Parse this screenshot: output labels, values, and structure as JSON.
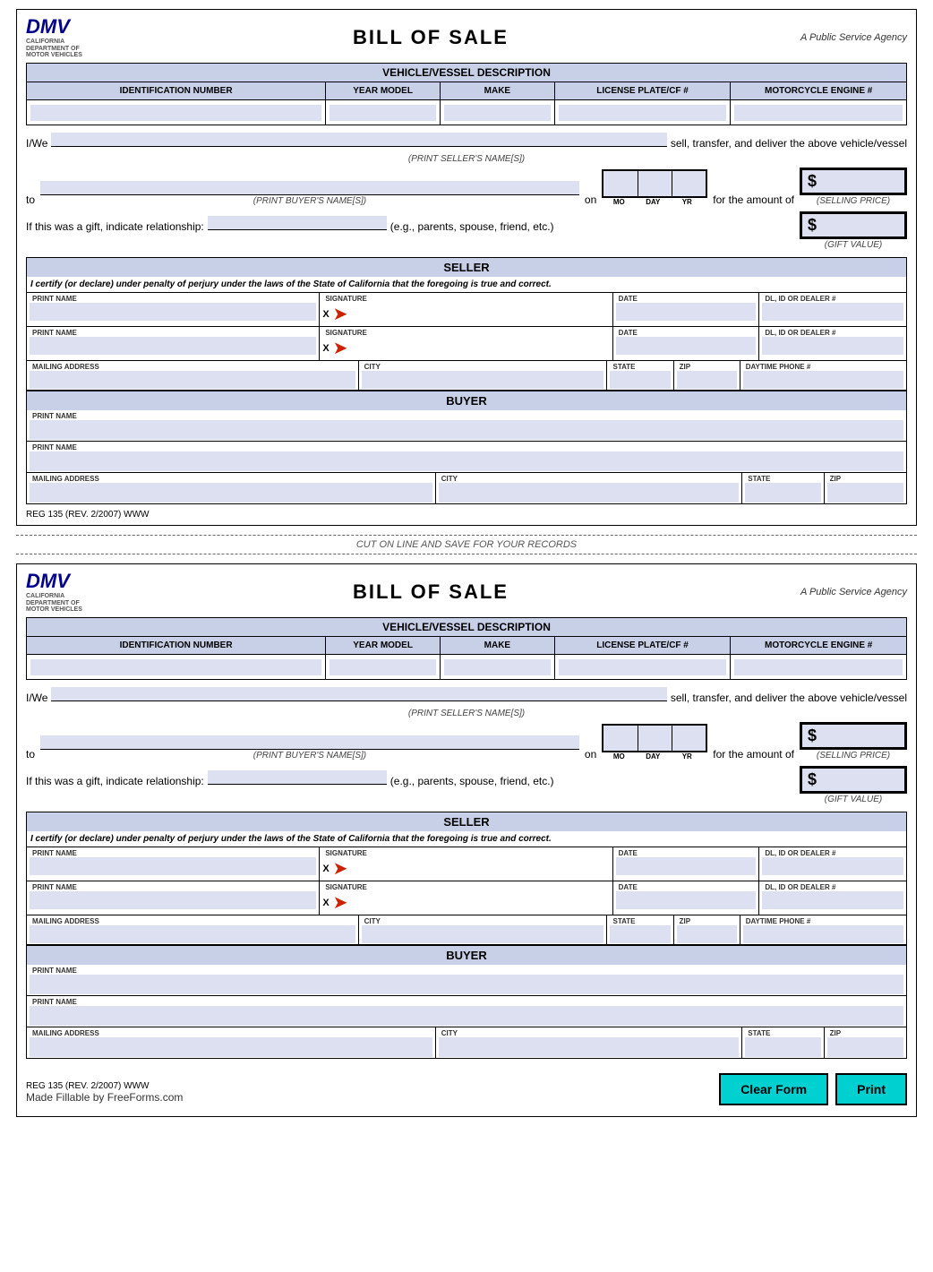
{
  "form": {
    "title": "BILL OF SALE",
    "agency": "A Public Service Agency",
    "logo_line1": "CALIFORNIA",
    "logo_dmv": "DMV",
    "logo_line2": "DEPARTMENT OF MOTOR VEHICLES",
    "vehicle_section": "VEHICLE/VESSEL DESCRIPTION",
    "col_id": "IDENTIFICATION NUMBER",
    "col_year": "YEAR MODEL",
    "col_make": "MAKE",
    "col_plate": "LICENSE PLATE/CF #",
    "col_engine": "MOTORCYCLE ENGINE #",
    "iwe_prefix": "I/We",
    "iwe_suffix": "sell, transfer, and deliver the above vehicle/vessel",
    "seller_label": "(PRINT SELLER'S NAME[S])",
    "to_prefix": "to",
    "on_label": "on",
    "buyer_label": "(PRINT BUYER'S NAME[S])",
    "for_amount": "for  the amount of",
    "selling_price_label": "(SELLING PRICE)",
    "dollar_sign": "$",
    "gift_prefix": "If this was a gift, indicate relationship:",
    "gift_eg": "(e.g., parents, spouse, friend, etc.)",
    "gift_value_label": "(GIFT VALUE)",
    "mo_label": "MO",
    "day_label": "DAY",
    "yr_label": "YR",
    "seller_title": "SELLER",
    "perjury_text": "I certify (or declare) under penalty of perjury under the laws of the State of California that the foregoing is true and correct.",
    "print_name": "PRINT NAME",
    "signature": "SIGNATURE",
    "date": "DATE",
    "dl_dealer": "DL, ID OR DEALER #",
    "mailing_address": "MAILING ADDRESS",
    "city": "CITY",
    "state": "STATE",
    "zip": "ZIP",
    "daytime_phone": "DAYTIME PHONE #",
    "buyer_title": "BUYER",
    "reg_text": "REG 135 (REV. 2/2007) WWW",
    "cut_line": "CUT ON LINE AND SAVE FOR YOUR RECORDS",
    "footer_freeforms": "Made Fillable by FreeForms.com",
    "btn_clear": "Clear Form",
    "btn_print": "Print",
    "sig_x": "X"
  }
}
